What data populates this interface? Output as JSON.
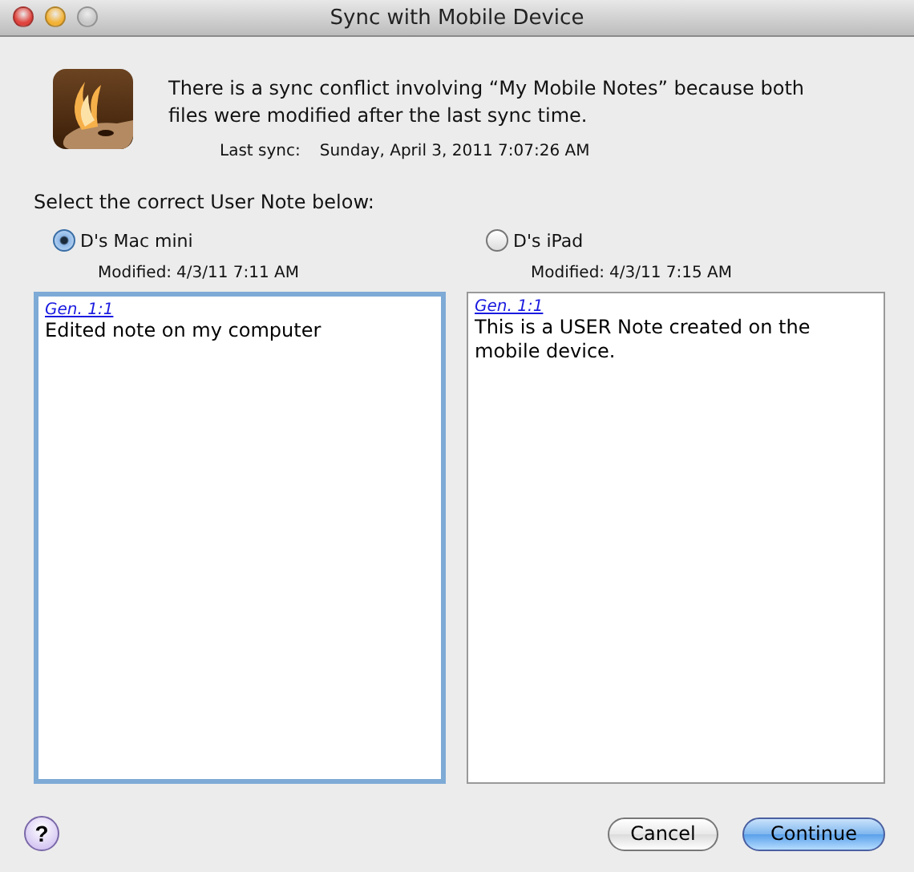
{
  "window": {
    "title": "Sync with Mobile Device"
  },
  "message": {
    "text": "There is a sync conflict involving “My Mobile Notes” because both files were modified after the last sync time.",
    "last_sync_label": "Last sync:",
    "last_sync_value": "Sunday, April 3, 2011 7:07:26 AM"
  },
  "prompt": "Select the correct User Note below:",
  "options": [
    {
      "device": "D's Mac mini",
      "selected": true,
      "focused": true,
      "modified_label": "Modified:",
      "modified_value": "4/3/11 7:11 AM",
      "reference": "Gen. 1:1",
      "note": "Edited note on my computer"
    },
    {
      "device": "D's iPad",
      "selected": false,
      "focused": false,
      "modified_label": "Modified:",
      "modified_value": "4/3/11 7:15 AM",
      "reference": "Gen. 1:1",
      "note": "This is a USER Note created on the mobile device."
    }
  ],
  "help": "?",
  "buttons": [
    {
      "label": "Cancel",
      "kind": "secondary"
    },
    {
      "label": "Continue",
      "kind": "default"
    }
  ]
}
